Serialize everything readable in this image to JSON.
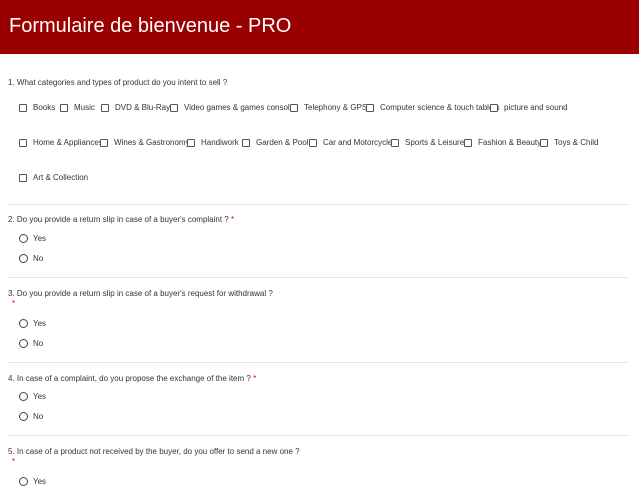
{
  "header": {
    "title": "Formulaire de bienvenue - PRO",
    "bg_color": "#9b0000"
  },
  "q1": {
    "label": "1. What categories and types of product do you intent to sell ?",
    "options": [
      "Books",
      "Music",
      "DVD & Blu-Ray",
      "Video games & games consoles",
      "Telephony & GPS",
      "Computer science & touch tablets",
      "picture and sound",
      "Home & Appliances",
      "Wines & Gastronomy",
      "Handiwork",
      "Garden & Pool",
      "Car and Motorcycle",
      "Sports & Leisure",
      "Fashion & Beauty",
      "Toys & Child",
      "Art & Collection"
    ]
  },
  "q2": {
    "label": "2. Do you provide a return slip in case of a buyer's complaint ?",
    "required": "*",
    "options": [
      "Yes",
      "No"
    ]
  },
  "q3": {
    "label": "3. Do you provide a return slip in case of a buyer's request for withdrawal ?",
    "required": "*",
    "options": [
      "Yes",
      "No"
    ]
  },
  "q4": {
    "label": "4. In case of a complaint, do you propose  the exchange of the item ?",
    "required": "*",
    "options": [
      "Yes",
      "No"
    ]
  },
  "q5": {
    "label": "5. In case of a product not received by the buyer,  do you offer to send a new one ?",
    "required": "*",
    "options": [
      "Yes"
    ]
  }
}
